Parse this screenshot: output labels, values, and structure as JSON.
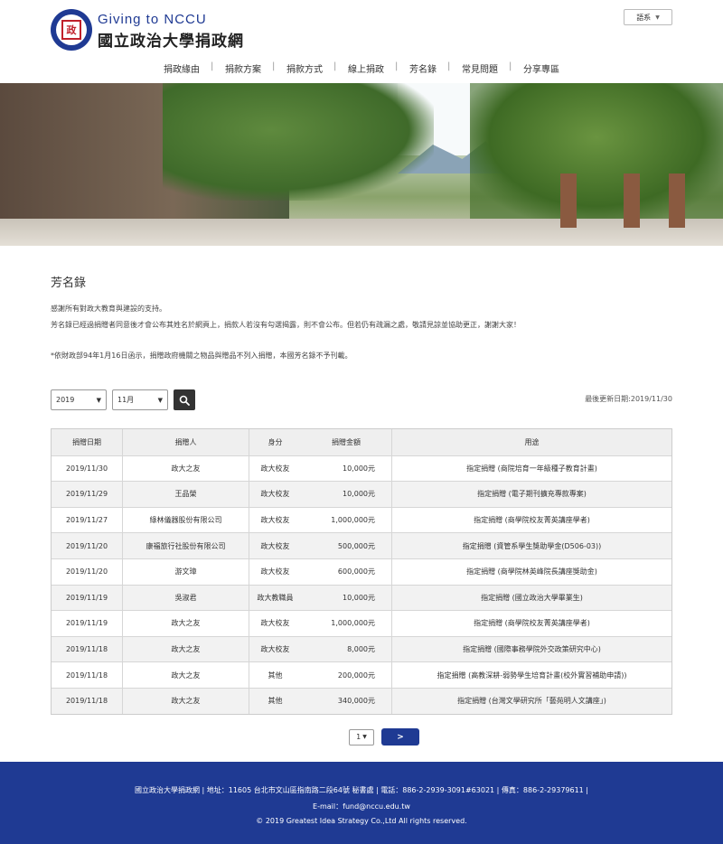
{
  "header": {
    "brand_en": "Giving to NCCU",
    "brand_zh": "國立政治大學捐政網",
    "logo_glyph": "政",
    "language": "語系"
  },
  "nav": {
    "items": [
      "捐政緣由",
      "捐款方案",
      "捐款方式",
      "線上捐政",
      "芳名錄",
      "常見問題",
      "分享專區"
    ]
  },
  "content": {
    "title": "芳名錄",
    "intro_1": "感謝所有對政大教育與建設的支持。",
    "intro_2": "芳名錄已經過捐贈者同意後才會公布其姓名於網頁上，捐款人若沒有勾選揭露，則不會公布。但若仍有疏漏之處，敬請見諒並協助更正，謝謝大家！",
    "intro_3": "*依財政部94年1月16日函示，捐贈政府機關之物品與贈品不列入捐贈，本國芳名錄不予刊載。"
  },
  "filters": {
    "year": "2019",
    "month": "11月",
    "updated": "最後更新日期:2019/11/30"
  },
  "table": {
    "headers": [
      "捐贈日期",
      "捐贈人",
      "身分",
      "捐贈金額",
      "用途"
    ],
    "rows": [
      {
        "date": "2019/11/30",
        "donor": "政大之友",
        "role": "政大校友",
        "amount": "10,000元",
        "use": "指定捐贈 (商院培育一年級種子教育計畫)"
      },
      {
        "date": "2019/11/29",
        "donor": "王品榮",
        "role": "政大校友",
        "amount": "10,000元",
        "use": "指定捐贈 (電子期刊擴充專款專案)"
      },
      {
        "date": "2019/11/27",
        "donor": "綠林儀器股份有限公司",
        "role": "政大校友",
        "amount": "1,000,000元",
        "use": "指定捐贈 (商學院校友菁英講座學者)"
      },
      {
        "date": "2019/11/20",
        "donor": "康福旅行社股份有限公司",
        "role": "政大校友",
        "amount": "500,000元",
        "use": "指定捐贈 (資管系學生獎助學金(D506-03))"
      },
      {
        "date": "2019/11/20",
        "donor": "游文璋",
        "role": "政大校友",
        "amount": "600,000元",
        "use": "指定捐贈 (商學院林英峰院長講座獎助金)"
      },
      {
        "date": "2019/11/19",
        "donor": "吳淑君",
        "role": "政大教職員",
        "amount": "10,000元",
        "use": "指定捐贈 (國立政治大學畢業生)"
      },
      {
        "date": "2019/11/19",
        "donor": "政大之友",
        "role": "政大校友",
        "amount": "1,000,000元",
        "use": "指定捐贈 (商學院校友菁英講座學者)"
      },
      {
        "date": "2019/11/18",
        "donor": "政大之友",
        "role": "政大校友",
        "amount": "8,000元",
        "use": "指定捐贈 (國際事務學院外交政策研究中心)"
      },
      {
        "date": "2019/11/18",
        "donor": "政大之友",
        "role": "其他",
        "amount": "200,000元",
        "use": "指定捐贈 (高教深耕-弱勢學生培育計畫(校外實習補助申請))"
      },
      {
        "date": "2019/11/18",
        "donor": "政大之友",
        "role": "其他",
        "amount": "340,000元",
        "use": "指定捐贈 (台灣文學研究所「藝苑明人文講座」)"
      }
    ]
  },
  "pager": {
    "page": "1",
    "next": ">"
  },
  "footer": {
    "line1": "國立政治大學捐政網 | 地址：11605 台北市文山區指南路二段64號 秘書處 | 電話：886-2-2939-3091#63021 | 傳真：886-2-29379611 |",
    "line2": "E-mail：fund@nccu.edu.tw",
    "line3": "© 2019 Greatest Idea Strategy Co.,Ltd All rights reserved."
  },
  "colors": {
    "brand": "#1f3a93",
    "footer_bg": "#1f3a93",
    "search_btn": "#333333"
  }
}
